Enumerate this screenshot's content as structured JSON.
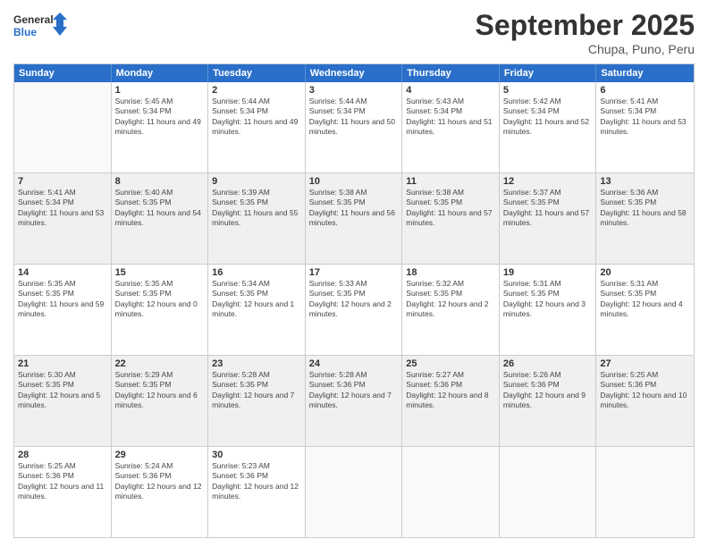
{
  "logo": {
    "line1": "General",
    "line2": "Blue"
  },
  "title": "September 2025",
  "subtitle": "Chupa, Puno, Peru",
  "days": [
    "Sunday",
    "Monday",
    "Tuesday",
    "Wednesday",
    "Thursday",
    "Friday",
    "Saturday"
  ],
  "rows": [
    [
      {
        "day": "",
        "empty": true
      },
      {
        "day": "1",
        "sunrise": "Sunrise: 5:45 AM",
        "sunset": "Sunset: 5:34 PM",
        "daylight": "Daylight: 11 hours and 49 minutes."
      },
      {
        "day": "2",
        "sunrise": "Sunrise: 5:44 AM",
        "sunset": "Sunset: 5:34 PM",
        "daylight": "Daylight: 11 hours and 49 minutes."
      },
      {
        "day": "3",
        "sunrise": "Sunrise: 5:44 AM",
        "sunset": "Sunset: 5:34 PM",
        "daylight": "Daylight: 11 hours and 50 minutes."
      },
      {
        "day": "4",
        "sunrise": "Sunrise: 5:43 AM",
        "sunset": "Sunset: 5:34 PM",
        "daylight": "Daylight: 11 hours and 51 minutes."
      },
      {
        "day": "5",
        "sunrise": "Sunrise: 5:42 AM",
        "sunset": "Sunset: 5:34 PM",
        "daylight": "Daylight: 11 hours and 52 minutes."
      },
      {
        "day": "6",
        "sunrise": "Sunrise: 5:41 AM",
        "sunset": "Sunset: 5:34 PM",
        "daylight": "Daylight: 11 hours and 53 minutes."
      }
    ],
    [
      {
        "day": "7",
        "sunrise": "Sunrise: 5:41 AM",
        "sunset": "Sunset: 5:34 PM",
        "daylight": "Daylight: 11 hours and 53 minutes."
      },
      {
        "day": "8",
        "sunrise": "Sunrise: 5:40 AM",
        "sunset": "Sunset: 5:35 PM",
        "daylight": "Daylight: 11 hours and 54 minutes."
      },
      {
        "day": "9",
        "sunrise": "Sunrise: 5:39 AM",
        "sunset": "Sunset: 5:35 PM",
        "daylight": "Daylight: 11 hours and 55 minutes."
      },
      {
        "day": "10",
        "sunrise": "Sunrise: 5:38 AM",
        "sunset": "Sunset: 5:35 PM",
        "daylight": "Daylight: 11 hours and 56 minutes."
      },
      {
        "day": "11",
        "sunrise": "Sunrise: 5:38 AM",
        "sunset": "Sunset: 5:35 PM",
        "daylight": "Daylight: 11 hours and 57 minutes."
      },
      {
        "day": "12",
        "sunrise": "Sunrise: 5:37 AM",
        "sunset": "Sunset: 5:35 PM",
        "daylight": "Daylight: 11 hours and 57 minutes."
      },
      {
        "day": "13",
        "sunrise": "Sunrise: 5:36 AM",
        "sunset": "Sunset: 5:35 PM",
        "daylight": "Daylight: 11 hours and 58 minutes."
      }
    ],
    [
      {
        "day": "14",
        "sunrise": "Sunrise: 5:35 AM",
        "sunset": "Sunset: 5:35 PM",
        "daylight": "Daylight: 11 hours and 59 minutes."
      },
      {
        "day": "15",
        "sunrise": "Sunrise: 5:35 AM",
        "sunset": "Sunset: 5:35 PM",
        "daylight": "Daylight: 12 hours and 0 minutes."
      },
      {
        "day": "16",
        "sunrise": "Sunrise: 5:34 AM",
        "sunset": "Sunset: 5:35 PM",
        "daylight": "Daylight: 12 hours and 1 minute."
      },
      {
        "day": "17",
        "sunrise": "Sunrise: 5:33 AM",
        "sunset": "Sunset: 5:35 PM",
        "daylight": "Daylight: 12 hours and 2 minutes."
      },
      {
        "day": "18",
        "sunrise": "Sunrise: 5:32 AM",
        "sunset": "Sunset: 5:35 PM",
        "daylight": "Daylight: 12 hours and 2 minutes."
      },
      {
        "day": "19",
        "sunrise": "Sunrise: 5:31 AM",
        "sunset": "Sunset: 5:35 PM",
        "daylight": "Daylight: 12 hours and 3 minutes."
      },
      {
        "day": "20",
        "sunrise": "Sunrise: 5:31 AM",
        "sunset": "Sunset: 5:35 PM",
        "daylight": "Daylight: 12 hours and 4 minutes."
      }
    ],
    [
      {
        "day": "21",
        "sunrise": "Sunrise: 5:30 AM",
        "sunset": "Sunset: 5:35 PM",
        "daylight": "Daylight: 12 hours and 5 minutes."
      },
      {
        "day": "22",
        "sunrise": "Sunrise: 5:29 AM",
        "sunset": "Sunset: 5:35 PM",
        "daylight": "Daylight: 12 hours and 6 minutes."
      },
      {
        "day": "23",
        "sunrise": "Sunrise: 5:28 AM",
        "sunset": "Sunset: 5:35 PM",
        "daylight": "Daylight: 12 hours and 7 minutes."
      },
      {
        "day": "24",
        "sunrise": "Sunrise: 5:28 AM",
        "sunset": "Sunset: 5:36 PM",
        "daylight": "Daylight: 12 hours and 7 minutes."
      },
      {
        "day": "25",
        "sunrise": "Sunrise: 5:27 AM",
        "sunset": "Sunset: 5:36 PM",
        "daylight": "Daylight: 12 hours and 8 minutes."
      },
      {
        "day": "26",
        "sunrise": "Sunrise: 5:26 AM",
        "sunset": "Sunset: 5:36 PM",
        "daylight": "Daylight: 12 hours and 9 minutes."
      },
      {
        "day": "27",
        "sunrise": "Sunrise: 5:25 AM",
        "sunset": "Sunset: 5:36 PM",
        "daylight": "Daylight: 12 hours and 10 minutes."
      }
    ],
    [
      {
        "day": "28",
        "sunrise": "Sunrise: 5:25 AM",
        "sunset": "Sunset: 5:36 PM",
        "daylight": "Daylight: 12 hours and 11 minutes."
      },
      {
        "day": "29",
        "sunrise": "Sunrise: 5:24 AM",
        "sunset": "Sunset: 5:36 PM",
        "daylight": "Daylight: 12 hours and 12 minutes."
      },
      {
        "day": "30",
        "sunrise": "Sunrise: 5:23 AM",
        "sunset": "Sunset: 5:36 PM",
        "daylight": "Daylight: 12 hours and 12 minutes."
      },
      {
        "day": "",
        "empty": true
      },
      {
        "day": "",
        "empty": true
      },
      {
        "day": "",
        "empty": true
      },
      {
        "day": "",
        "empty": true
      }
    ]
  ]
}
